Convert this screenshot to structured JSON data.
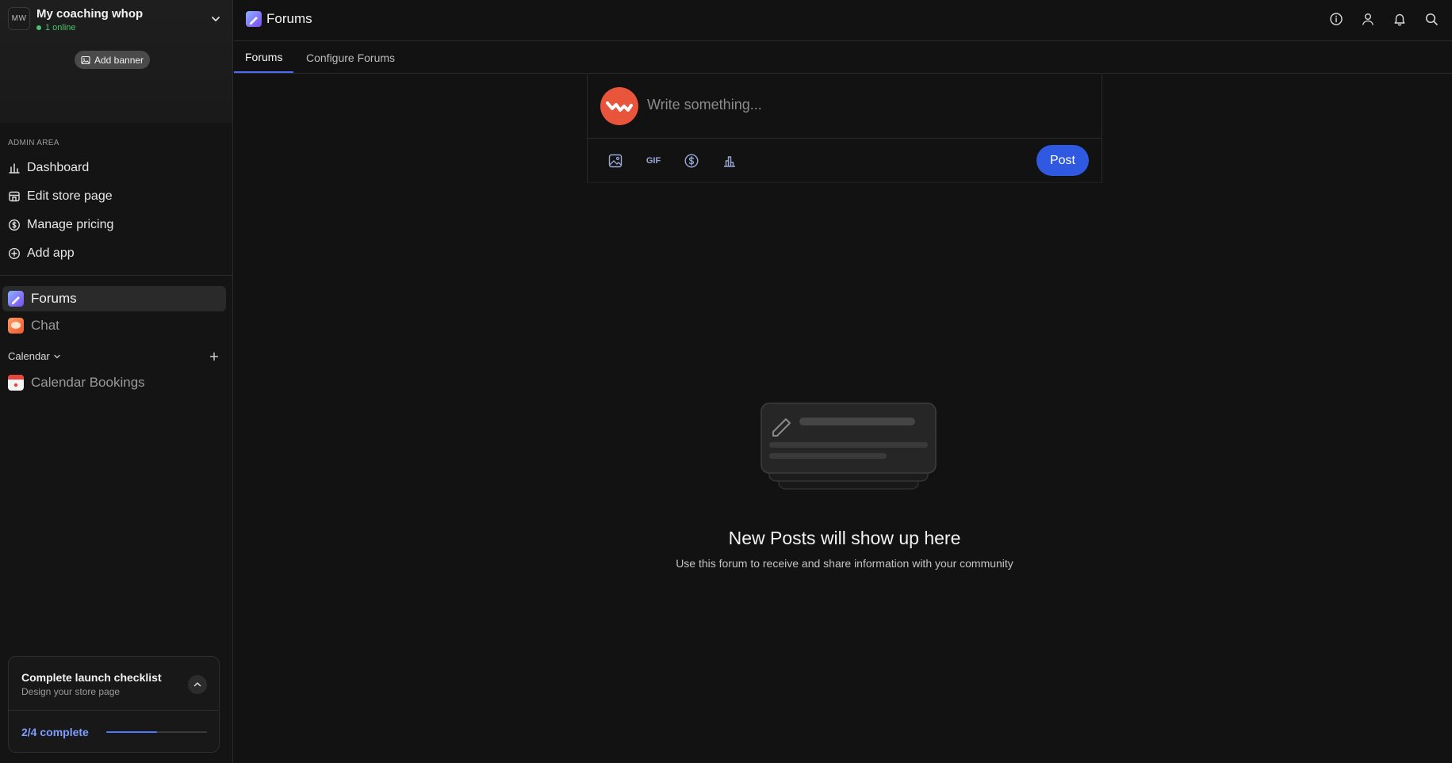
{
  "workspace": {
    "avatar_initials": "MW",
    "name": "My coaching whop",
    "online_text": "1 online",
    "add_banner_label": "Add banner"
  },
  "admin": {
    "section_label": "ADMIN AREA",
    "items": [
      {
        "label": "Dashboard",
        "icon": "chart-icon"
      },
      {
        "label": "Edit store page",
        "icon": "store-icon"
      },
      {
        "label": "Manage pricing",
        "icon": "dollar-circle-icon"
      },
      {
        "label": "Add app",
        "icon": "plus-circle-icon"
      }
    ]
  },
  "apps": [
    {
      "label": "Forums",
      "active": true
    },
    {
      "label": "Chat",
      "active": false
    }
  ],
  "calendar_section": {
    "label": "Calendar",
    "items": [
      {
        "label": "Calendar Bookings"
      }
    ]
  },
  "checklist": {
    "title": "Complete launch checklist",
    "subtitle": "Design your store page",
    "progress_text": "2/4 complete",
    "progress_fraction": 0.5
  },
  "topbar": {
    "title": "Forums",
    "icons": [
      "info-icon",
      "user-icon",
      "bell-icon",
      "search-icon"
    ]
  },
  "tabs": [
    {
      "label": "Forums",
      "active": true
    },
    {
      "label": "Configure Forums",
      "active": false
    }
  ],
  "composer": {
    "placeholder": "Write something...",
    "gif_label": "GIF",
    "post_label": "Post"
  },
  "empty_state": {
    "title": "New Posts will show up here",
    "subtitle": "Use this forum to receive and share information with your community"
  },
  "colors": {
    "accent": "#2f59e0",
    "online": "#4cc36b",
    "avatar": "#e8553a"
  }
}
